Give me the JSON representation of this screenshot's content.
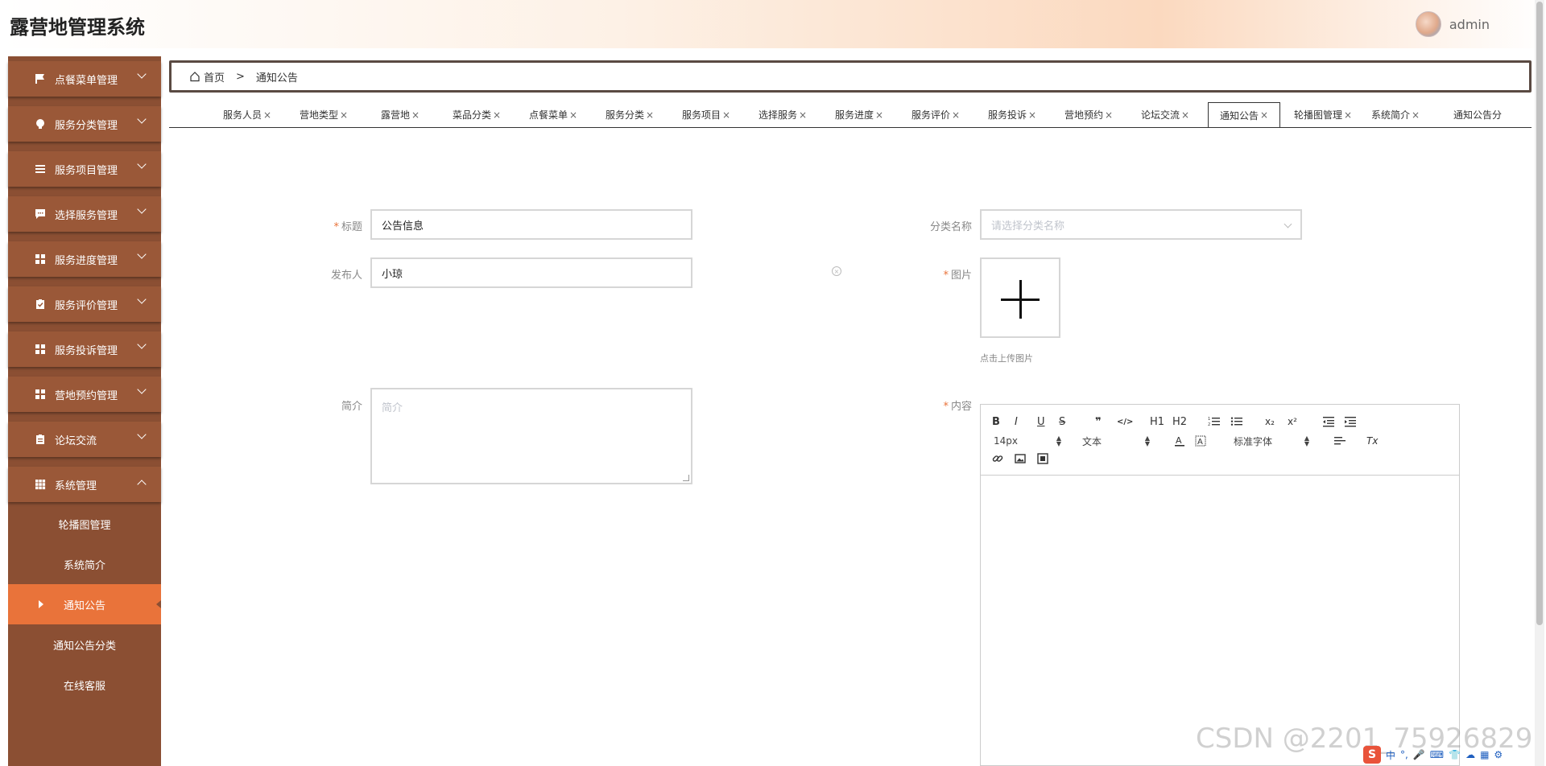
{
  "app": {
    "title": "露营地管理系统",
    "user": "admin"
  },
  "sidebar": {
    "menus": [
      {
        "label": "点餐菜单管理",
        "icon": "flag-icon"
      },
      {
        "label": "服务分类管理",
        "icon": "lightbulb-icon"
      },
      {
        "label": "服务项目管理",
        "icon": "list-icon"
      },
      {
        "label": "选择服务管理",
        "icon": "chat-icon"
      },
      {
        "label": "服务进度管理",
        "icon": "grid-icon"
      },
      {
        "label": "服务评价管理",
        "icon": "clipboard-check-icon"
      },
      {
        "label": "服务投诉管理",
        "icon": "grid-icon"
      },
      {
        "label": "营地预约管理",
        "icon": "grid-icon"
      },
      {
        "label": "论坛交流",
        "icon": "clipboard-icon"
      },
      {
        "label": "系统管理",
        "icon": "table-icon"
      }
    ],
    "submenu": [
      "轮播图管理",
      "系统简介",
      "通知公告",
      "通知公告分类",
      "在线客服"
    ],
    "active_submenu": "通知公告"
  },
  "breadcrumb": {
    "home": "首页",
    "separator": ">",
    "current": "通知公告"
  },
  "tabs": [
    "服务人员",
    "营地类型",
    "露营地",
    "菜品分类",
    "点餐菜单",
    "服务分类",
    "服务项目",
    "选择服务",
    "服务进度",
    "服务评价",
    "服务投诉",
    "营地预约",
    "论坛交流",
    "通知公告",
    "轮播图管理",
    "系统简介",
    "通知公告分"
  ],
  "active_tab": "通知公告",
  "tab_close": "×",
  "form": {
    "title_label": "标题",
    "title_value": "公告信息",
    "publisher_label": "发布人",
    "publisher_value": "小琼",
    "category_label": "分类名称",
    "category_placeholder": "请选择分类名称",
    "image_label": "图片",
    "upload_hint": "点击上传图片",
    "summary_label": "简介",
    "summary_placeholder": "简介",
    "content_label": "内容",
    "required_mark": "*"
  },
  "editor": {
    "font_size": "14px",
    "block_type": "文本",
    "font_family": "标准字体",
    "buttons": {
      "bold": "B",
      "italic": "I",
      "underline": "U",
      "strike": "S",
      "blockquote": "❞",
      "code": "</>",
      "h1": "H1",
      "h2": "H2",
      "subscript": "x₂",
      "superscript": "x²",
      "clean": "Tx"
    }
  },
  "watermark": "CSDN @2201_75926829",
  "ime": {
    "lang": "中"
  },
  "colors": {
    "sidebar": "#8b4f33",
    "menu_item": "#9a5838",
    "active": "#e9733a",
    "required": "#e9733a"
  }
}
